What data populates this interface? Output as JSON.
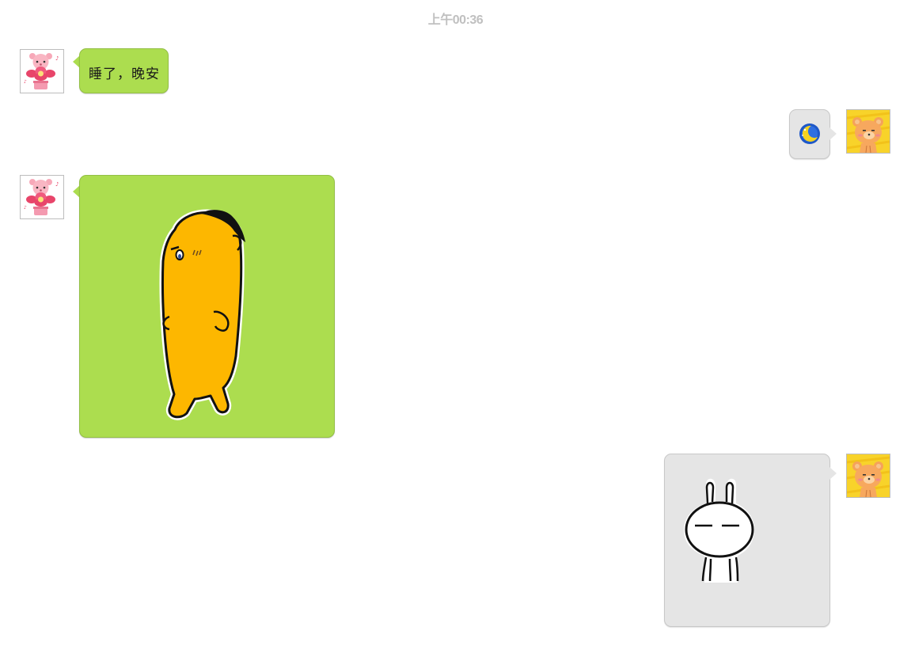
{
  "chat": {
    "timestamp": "上午00:36",
    "messages": [
      {
        "sender": "other",
        "type": "text",
        "text": "睡了，晚安"
      },
      {
        "sender": "me",
        "type": "emoji",
        "emoji": "moon-emoji"
      },
      {
        "sender": "other",
        "type": "sticker",
        "sticker": "walking-yellow-blob-sticker"
      },
      {
        "sender": "me",
        "type": "sticker",
        "sticker": "rabbit-sticker"
      }
    ]
  },
  "colors": {
    "incoming_bubble": "#acdd4f",
    "outgoing_bubble": "#e5e5e5",
    "timestamp_text": "#c0c0c0"
  },
  "avatars": {
    "other": "pink-bear-flower-avatar",
    "me": "orange-bear-avatar"
  }
}
